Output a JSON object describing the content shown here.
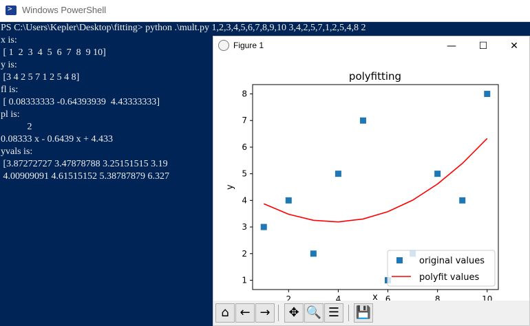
{
  "powershell": {
    "title": "Windows PowerShell",
    "console_lines": [
      "PS C:\\Users\\Kepler\\Desktop\\fitting> python .\\mult.py 1,2,3,4,5,6,7,8,9,10 3,4,2,5,7,1,2,5,4,8 2",
      "x is:",
      " [ 1  2  3  4  5  6  7  8  9 10]",
      "y is:",
      " [3 4 2 5 7 1 2 5 4 8]",
      "fl is:",
      " [ 0.08333333 -0.64393939  4.43333333]",
      "pl is:",
      "           2",
      "0.08333 x - 0.6439 x + 4.433",
      "yvals is:",
      " [3.87272727 3.47878788 3.25151515 3.19",
      " 4.00909091 4.61515152 5.38787879 6.327"
    ]
  },
  "figure": {
    "title": "Figure 1",
    "window_buttons": {
      "minimize": "—",
      "maximize": "☐",
      "close": "✕"
    },
    "toolbar": {
      "home": "⌂",
      "back": "←",
      "forward": "→",
      "pan": "✥",
      "zoom": "🔍",
      "configure": "☰",
      "save": "💾"
    }
  },
  "chart_data": {
    "type": "scatter",
    "title": "polyfitting",
    "xlabel": "x",
    "ylabel": "y",
    "xlim": [
      0.55,
      10.45
    ],
    "ylim": [
      0.65,
      8.35
    ],
    "xticks": [
      2,
      4,
      6,
      8,
      10
    ],
    "yticks": [
      1,
      2,
      3,
      4,
      5,
      6,
      7,
      8
    ],
    "grid": false,
    "legend_position": "lower-right",
    "series": [
      {
        "name": "original values",
        "kind": "scatter",
        "marker": "square",
        "color": "#1f77b4",
        "x": [
          1,
          2,
          3,
          4,
          5,
          6,
          7,
          8,
          9,
          10
        ],
        "y": [
          3,
          4,
          2,
          5,
          7,
          1,
          2,
          5,
          4,
          8
        ]
      },
      {
        "name": "polyfit values",
        "kind": "line",
        "color": "#ff0000",
        "x": [
          1,
          2,
          3,
          4,
          5,
          6,
          7,
          8,
          9,
          10
        ],
        "y": [
          3.87272727,
          3.47878788,
          3.25151515,
          3.19090909,
          3.3,
          3.57575758,
          4.00909091,
          4.61515152,
          5.38787879,
          6.32727273
        ]
      }
    ]
  }
}
